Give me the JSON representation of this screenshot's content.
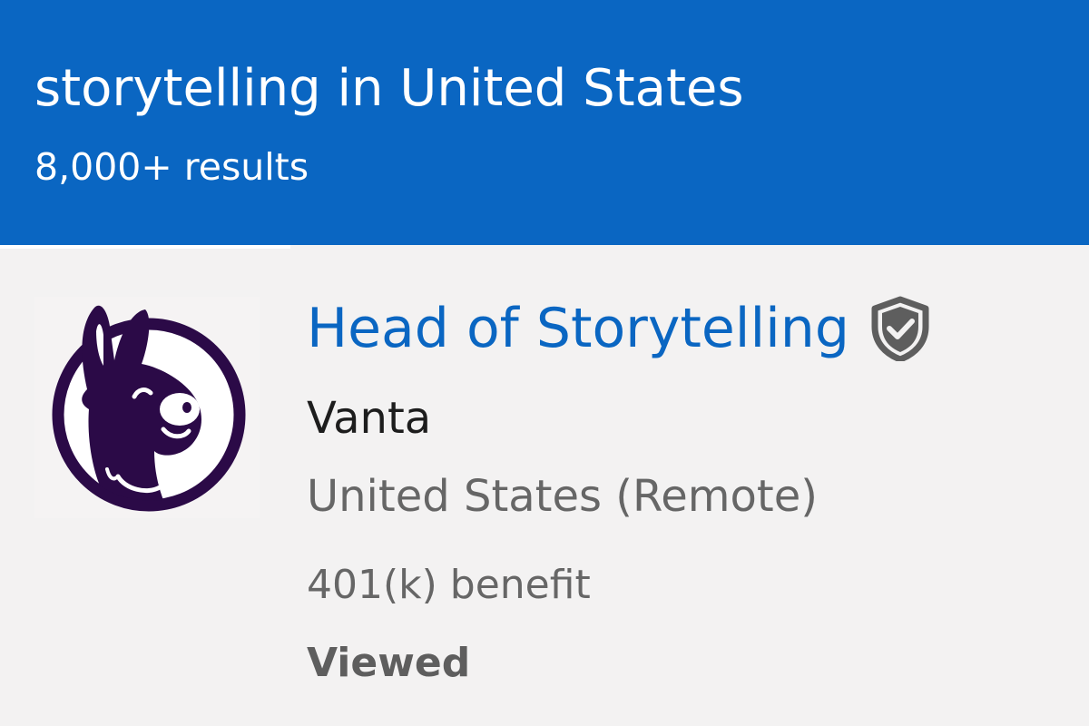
{
  "search": {
    "title": "storytelling in United States",
    "result_count": "8,000+ results"
  },
  "job": {
    "title": "Head of Storytelling",
    "company": "Vanta",
    "location": "United States (Remote)",
    "insight": "401(k) benefit",
    "status": "Viewed",
    "verified_icon": "shield-check-icon",
    "logo_icon": "llama-logo"
  },
  "colors": {
    "brand_blue": "#0a66c2",
    "logo_purple": "#2b0a47",
    "card_background": "#f3f2f2",
    "muted_text": "#666666"
  }
}
